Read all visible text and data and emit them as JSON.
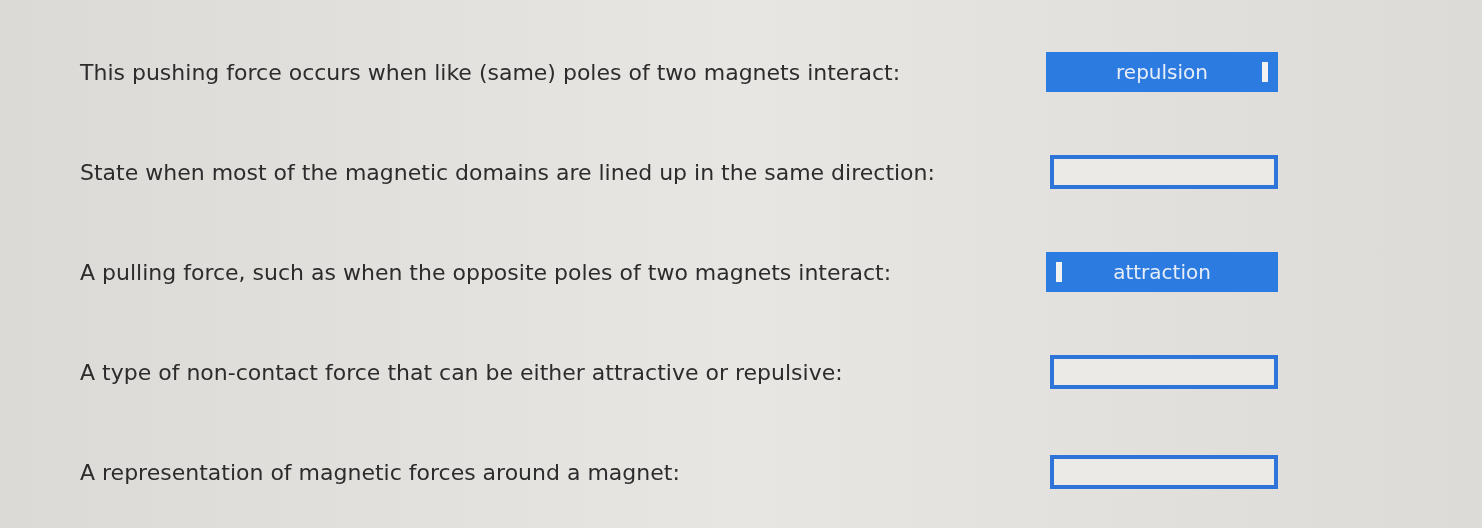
{
  "questions": [
    {
      "prompt": "This pushing force occurs when like (same) poles of two magnets interact:",
      "answer": "repulsion",
      "handle_left": false
    },
    {
      "prompt": "State when most of the magnetic domains are lined up in the same direction:"
    },
    {
      "prompt": "A pulling force, such as when the opposite poles of two magnets interact:",
      "answer": "attraction",
      "handle_left": true
    },
    {
      "prompt": "A type of non-contact force that can be either attractive or repulsive:"
    },
    {
      "prompt": "A representation of magnetic forces around a magnet:"
    }
  ]
}
